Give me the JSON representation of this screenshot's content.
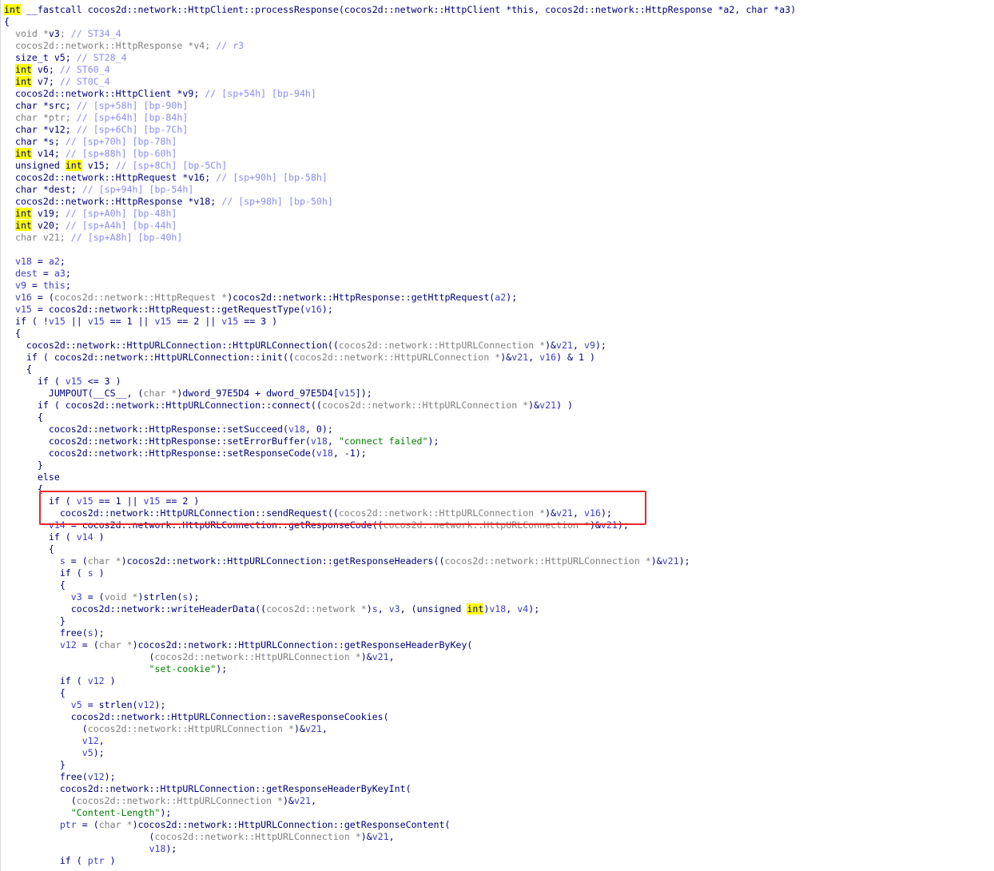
{
  "colors": {
    "default": "#000080",
    "gray": "#808080",
    "comment": "#8a8aff",
    "variable": "#3333cc",
    "string": "#008000",
    "highlight_bg": "#ffff00",
    "annotation_box": "#e8262a"
  },
  "code_lines": [
    {
      "indent": 0,
      "tokens": [
        [
          "hl",
          "int"
        ],
        [
          "d",
          " __fastcall cocos2d::network::HttpClient::processResponse(cocos2d::network::HttpClient *this, cocos2d::network::HttpResponse *a2, char *a3)"
        ]
      ]
    },
    {
      "indent": 0,
      "tokens": [
        [
          "d",
          "{"
        ]
      ]
    },
    {
      "indent": 1,
      "tokens": [
        [
          "g",
          "void *"
        ],
        [
          "d",
          "v3"
        ],
        [
          "g",
          "; "
        ],
        [
          "c",
          "// ST34_4"
        ]
      ]
    },
    {
      "indent": 1,
      "tokens": [
        [
          "g",
          "cocos2d::network::HttpResponse *v4; "
        ],
        [
          "c",
          "// r3"
        ]
      ]
    },
    {
      "indent": 1,
      "tokens": [
        [
          "d",
          "size_t v5; "
        ],
        [
          "c",
          "// ST28_4"
        ]
      ]
    },
    {
      "indent": 1,
      "tokens": [
        [
          "hl",
          "int"
        ],
        [
          "d",
          " v6; "
        ],
        [
          "c",
          "// ST60_4"
        ]
      ]
    },
    {
      "indent": 1,
      "tokens": [
        [
          "hl",
          "int"
        ],
        [
          "d",
          " v7; "
        ],
        [
          "c",
          "// ST0C_4"
        ]
      ]
    },
    {
      "indent": 1,
      "tokens": [
        [
          "d",
          "cocos2d::network::HttpClient *v9; "
        ],
        [
          "c",
          "// [sp+54h] [bp-94h]"
        ]
      ]
    },
    {
      "indent": 1,
      "tokens": [
        [
          "d",
          "char *src; "
        ],
        [
          "c",
          "// [sp+58h] [bp-90h]"
        ]
      ]
    },
    {
      "indent": 1,
      "tokens": [
        [
          "g",
          "char *ptr; "
        ],
        [
          "c",
          "// [sp+64h] [bp-84h]"
        ]
      ]
    },
    {
      "indent": 1,
      "tokens": [
        [
          "d",
          "char *v12; "
        ],
        [
          "c",
          "// [sp+6Ch] [bp-7Ch]"
        ]
      ]
    },
    {
      "indent": 1,
      "tokens": [
        [
          "d",
          "char *s; "
        ],
        [
          "c",
          "// [sp+70h] [bp-78h]"
        ]
      ]
    },
    {
      "indent": 1,
      "tokens": [
        [
          "hl",
          "int"
        ],
        [
          "d",
          " v14; "
        ],
        [
          "c",
          "// [sp+88h] [bp-60h]"
        ]
      ]
    },
    {
      "indent": 1,
      "tokens": [
        [
          "d",
          "unsigned "
        ],
        [
          "hl",
          "int"
        ],
        [
          "d",
          " v15; "
        ],
        [
          "c",
          "// [sp+8Ch] [bp-5Ch]"
        ]
      ]
    },
    {
      "indent": 1,
      "tokens": [
        [
          "d",
          "cocos2d::network::HttpRequest *v16; "
        ],
        [
          "c",
          "// [sp+90h] [bp-58h]"
        ]
      ]
    },
    {
      "indent": 1,
      "tokens": [
        [
          "d",
          "char *dest; "
        ],
        [
          "c",
          "// [sp+94h] [bp-54h]"
        ]
      ]
    },
    {
      "indent": 1,
      "tokens": [
        [
          "d",
          "cocos2d::network::HttpResponse *v18; "
        ],
        [
          "c",
          "// [sp+98h] [bp-50h]"
        ]
      ]
    },
    {
      "indent": 1,
      "tokens": [
        [
          "hl",
          "int"
        ],
        [
          "d",
          " v19; "
        ],
        [
          "c",
          "// [sp+A0h] [bp-48h]"
        ]
      ]
    },
    {
      "indent": 1,
      "tokens": [
        [
          "hl",
          "int"
        ],
        [
          "d",
          " v20; "
        ],
        [
          "c",
          "// [sp+A4h] [bp-44h]"
        ]
      ]
    },
    {
      "indent": 1,
      "tokens": [
        [
          "g",
          "char v21; "
        ],
        [
          "c",
          "// [sp+A8h] [bp-40h]"
        ]
      ]
    },
    {
      "indent": 0,
      "tokens": []
    },
    {
      "indent": 1,
      "tokens": [
        [
          "v",
          "v18"
        ],
        [
          "d",
          " = "
        ],
        [
          "v",
          "a2"
        ],
        [
          "d",
          ";"
        ]
      ]
    },
    {
      "indent": 1,
      "tokens": [
        [
          "v",
          "dest"
        ],
        [
          "d",
          " = "
        ],
        [
          "v",
          "a3"
        ],
        [
          "d",
          ";"
        ]
      ]
    },
    {
      "indent": 1,
      "tokens": [
        [
          "v",
          "v9"
        ],
        [
          "d",
          " = "
        ],
        [
          "v",
          "this"
        ],
        [
          "d",
          ";"
        ]
      ]
    },
    {
      "indent": 1,
      "tokens": [
        [
          "v",
          "v16"
        ],
        [
          "d",
          " = ("
        ],
        [
          "g",
          "cocos2d::network::HttpRequest *"
        ],
        [
          "d",
          ")cocos2d::network::HttpResponse::getHttpRequest("
        ],
        [
          "v",
          "a2"
        ],
        [
          "d",
          ");"
        ]
      ]
    },
    {
      "indent": 1,
      "tokens": [
        [
          "v",
          "v15"
        ],
        [
          "d",
          " = cocos2d::network::HttpRequest::getRequestType("
        ],
        [
          "v",
          "v16"
        ],
        [
          "d",
          ");"
        ]
      ]
    },
    {
      "indent": 1,
      "tokens": [
        [
          "d",
          "if ( !"
        ],
        [
          "v",
          "v15"
        ],
        [
          "d",
          " || "
        ],
        [
          "v",
          "v15"
        ],
        [
          "d",
          " == 1 || "
        ],
        [
          "v",
          "v15"
        ],
        [
          "d",
          " == 2 || "
        ],
        [
          "v",
          "v15"
        ],
        [
          "d",
          " == 3 )"
        ]
      ]
    },
    {
      "indent": 1,
      "tokens": [
        [
          "d",
          "{"
        ]
      ]
    },
    {
      "indent": 2,
      "tokens": [
        [
          "d",
          "cocos2d::network::HttpURLConnection::HttpURLConnection(("
        ],
        [
          "g",
          "cocos2d::network::HttpURLConnection *"
        ],
        [
          "d",
          ")&"
        ],
        [
          "v",
          "v21"
        ],
        [
          "d",
          ", "
        ],
        [
          "v",
          "v9"
        ],
        [
          "d",
          ");"
        ]
      ]
    },
    {
      "indent": 2,
      "tokens": [
        [
          "d",
          "if ( cocos2d::network::HttpURLConnection::init(("
        ],
        [
          "g",
          "cocos2d::network::HttpURLConnection *"
        ],
        [
          "d",
          ")&"
        ],
        [
          "v",
          "v21"
        ],
        [
          "d",
          ", "
        ],
        [
          "v",
          "v16"
        ],
        [
          "d",
          ") & 1 )"
        ]
      ]
    },
    {
      "indent": 2,
      "tokens": [
        [
          "d",
          "{"
        ]
      ]
    },
    {
      "indent": 3,
      "tokens": [
        [
          "d",
          "if ( "
        ],
        [
          "v",
          "v15"
        ],
        [
          "d",
          " <= 3 )"
        ]
      ]
    },
    {
      "indent": 4,
      "tokens": [
        [
          "d",
          "JUMPOUT(__CS__, ("
        ],
        [
          "g",
          "char *"
        ],
        [
          "d",
          ")dword_97E5D4 + dword_97E5D4["
        ],
        [
          "v",
          "v15"
        ],
        [
          "d",
          "]);"
        ]
      ]
    },
    {
      "indent": 3,
      "tokens": [
        [
          "d",
          "if ( cocos2d::network::HttpURLConnection::connect(("
        ],
        [
          "g",
          "cocos2d::network::HttpURLConnection *"
        ],
        [
          "d",
          ")&"
        ],
        [
          "v",
          "v21"
        ],
        [
          "d",
          ") )"
        ]
      ]
    },
    {
      "indent": 3,
      "tokens": [
        [
          "d",
          "{"
        ]
      ]
    },
    {
      "indent": 4,
      "tokens": [
        [
          "d",
          "cocos2d::network::HttpResponse::setSucceed("
        ],
        [
          "v",
          "v18"
        ],
        [
          "d",
          ", 0);"
        ]
      ]
    },
    {
      "indent": 4,
      "tokens": [
        [
          "d",
          "cocos2d::network::HttpResponse::setErrorBuffer("
        ],
        [
          "v",
          "v18"
        ],
        [
          "d",
          ", "
        ],
        [
          "s",
          "\"connect failed\""
        ],
        [
          "d",
          ");"
        ]
      ]
    },
    {
      "indent": 4,
      "tokens": [
        [
          "d",
          "cocos2d::network::HttpResponse::setResponseCode("
        ],
        [
          "v",
          "v18"
        ],
        [
          "d",
          ", -1);"
        ]
      ]
    },
    {
      "indent": 3,
      "tokens": [
        [
          "d",
          "}"
        ]
      ]
    },
    {
      "indent": 3,
      "tokens": [
        [
          "d",
          "else"
        ]
      ]
    },
    {
      "indent": 3,
      "tokens": [
        [
          "d",
          "{"
        ]
      ]
    },
    {
      "indent": 4,
      "tokens": [
        [
          "d",
          "if ( "
        ],
        [
          "v",
          "v15"
        ],
        [
          "d",
          " == 1 || "
        ],
        [
          "v",
          "v15"
        ],
        [
          "d",
          " == 2 )"
        ]
      ]
    },
    {
      "indent": 5,
      "tokens": [
        [
          "d",
          "cocos2d::network::HttpURLConnection::sendRequest(("
        ],
        [
          "g",
          "cocos2d::network::HttpURLConnection *"
        ],
        [
          "d",
          ")&"
        ],
        [
          "v",
          "v21"
        ],
        [
          "d",
          ", "
        ],
        [
          "v",
          "v16"
        ],
        [
          "d",
          ");"
        ]
      ]
    },
    {
      "indent": 4,
      "tokens": [
        [
          "v",
          "v14"
        ],
        [
          "d",
          " = cocos2d::network::HttpURLConnection::getResponseCode(("
        ],
        [
          "g",
          "cocos2d::network::HttpURLConnection *"
        ],
        [
          "d",
          ")&"
        ],
        [
          "v",
          "v21"
        ],
        [
          "d",
          ");"
        ]
      ]
    },
    {
      "indent": 4,
      "tokens": [
        [
          "d",
          "if ( "
        ],
        [
          "v",
          "v14"
        ],
        [
          "d",
          " )"
        ]
      ]
    },
    {
      "indent": 4,
      "tokens": [
        [
          "d",
          "{"
        ]
      ]
    },
    {
      "indent": 5,
      "tokens": [
        [
          "v",
          "s"
        ],
        [
          "d",
          " = ("
        ],
        [
          "g",
          "char *"
        ],
        [
          "d",
          ")cocos2d::network::HttpURLConnection::getResponseHeaders(("
        ],
        [
          "g",
          "cocos2d::network::HttpURLConnection *"
        ],
        [
          "d",
          ")&"
        ],
        [
          "v",
          "v21"
        ],
        [
          "d",
          ");"
        ]
      ]
    },
    {
      "indent": 5,
      "tokens": [
        [
          "d",
          "if ( "
        ],
        [
          "v",
          "s"
        ],
        [
          "d",
          " )"
        ]
      ]
    },
    {
      "indent": 5,
      "tokens": [
        [
          "d",
          "{"
        ]
      ]
    },
    {
      "indent": 6,
      "tokens": [
        [
          "v",
          "v3"
        ],
        [
          "d",
          " = ("
        ],
        [
          "g",
          "void *"
        ],
        [
          "d",
          ")strlen("
        ],
        [
          "v",
          "s"
        ],
        [
          "d",
          ");"
        ]
      ]
    },
    {
      "indent": 6,
      "tokens": [
        [
          "d",
          "cocos2d::network::writeHeaderData(("
        ],
        [
          "g",
          "cocos2d::network *"
        ],
        [
          "d",
          ")"
        ],
        [
          "v",
          "s"
        ],
        [
          "d",
          ", "
        ],
        [
          "v",
          "v3"
        ],
        [
          "d",
          ", (unsigned "
        ],
        [
          "hl",
          "int"
        ],
        [
          "d",
          ")"
        ],
        [
          "v",
          "v18"
        ],
        [
          "d",
          ", "
        ],
        [
          "v",
          "v4"
        ],
        [
          "d",
          ");"
        ]
      ]
    },
    {
      "indent": 5,
      "tokens": [
        [
          "d",
          "}"
        ]
      ]
    },
    {
      "indent": 5,
      "tokens": [
        [
          "d",
          "free("
        ],
        [
          "v",
          "s"
        ],
        [
          "d",
          ");"
        ]
      ]
    },
    {
      "indent": 5,
      "tokens": [
        [
          "v",
          "v12"
        ],
        [
          "d",
          " = ("
        ],
        [
          "g",
          "char *"
        ],
        [
          "d",
          ")cocos2d::network::HttpURLConnection::getResponseHeaderByKey("
        ]
      ]
    },
    {
      "indent": 13,
      "tokens": [
        [
          "d",
          "("
        ],
        [
          "g",
          "cocos2d::network::HttpURLConnection *"
        ],
        [
          "d",
          ")&"
        ],
        [
          "v",
          "v21"
        ],
        [
          "d",
          ","
        ]
      ]
    },
    {
      "indent": 13,
      "tokens": [
        [
          "s",
          "\"set-cookie\""
        ],
        [
          "d",
          ");"
        ]
      ]
    },
    {
      "indent": 5,
      "tokens": [
        [
          "d",
          "if ( "
        ],
        [
          "v",
          "v12"
        ],
        [
          "d",
          " )"
        ]
      ]
    },
    {
      "indent": 5,
      "tokens": [
        [
          "d",
          "{"
        ]
      ]
    },
    {
      "indent": 6,
      "tokens": [
        [
          "v",
          "v5"
        ],
        [
          "d",
          " = strlen("
        ],
        [
          "v",
          "v12"
        ],
        [
          "d",
          ");"
        ]
      ]
    },
    {
      "indent": 6,
      "tokens": [
        [
          "d",
          "cocos2d::network::HttpURLConnection::saveResponseCookies("
        ]
      ]
    },
    {
      "indent": 7,
      "tokens": [
        [
          "d",
          "("
        ],
        [
          "g",
          "cocos2d::network::HttpURLConnection *"
        ],
        [
          "d",
          ")&"
        ],
        [
          "v",
          "v21"
        ],
        [
          "d",
          ","
        ]
      ]
    },
    {
      "indent": 7,
      "tokens": [
        [
          "v",
          "v12"
        ],
        [
          "d",
          ","
        ]
      ]
    },
    {
      "indent": 7,
      "tokens": [
        [
          "v",
          "v5"
        ],
        [
          "d",
          ");"
        ]
      ]
    },
    {
      "indent": 5,
      "tokens": [
        [
          "d",
          "}"
        ]
      ]
    },
    {
      "indent": 5,
      "tokens": [
        [
          "d",
          "free("
        ],
        [
          "v",
          "v12"
        ],
        [
          "d",
          ");"
        ]
      ]
    },
    {
      "indent": 5,
      "tokens": [
        [
          "d",
          "cocos2d::network::HttpURLConnection::getResponseHeaderByKeyInt("
        ]
      ]
    },
    {
      "indent": 6,
      "tokens": [
        [
          "d",
          "("
        ],
        [
          "g",
          "cocos2d::network::HttpURLConnection *"
        ],
        [
          "d",
          ")&"
        ],
        [
          "v",
          "v21"
        ],
        [
          "d",
          ","
        ]
      ]
    },
    {
      "indent": 6,
      "tokens": [
        [
          "s",
          "\"Content-Length\""
        ],
        [
          "d",
          ");"
        ]
      ]
    },
    {
      "indent": 5,
      "tokens": [
        [
          "v",
          "ptr"
        ],
        [
          "d",
          " = ("
        ],
        [
          "g",
          "char *"
        ],
        [
          "d",
          ")cocos2d::network::HttpURLConnection::getResponseContent("
        ]
      ]
    },
    {
      "indent": 13,
      "tokens": [
        [
          "d",
          "("
        ],
        [
          "g",
          "cocos2d::network::HttpURLConnection *"
        ],
        [
          "d",
          ")&"
        ],
        [
          "v",
          "v21"
        ],
        [
          "d",
          ","
        ]
      ]
    },
    {
      "indent": 13,
      "tokens": [
        [
          "v",
          "v18"
        ],
        [
          "d",
          ");"
        ]
      ]
    },
    {
      "indent": 5,
      "tokens": [
        [
          "d",
          "if ( "
        ],
        [
          "v",
          "ptr"
        ],
        [
          "d",
          " )"
        ]
      ]
    }
  ]
}
